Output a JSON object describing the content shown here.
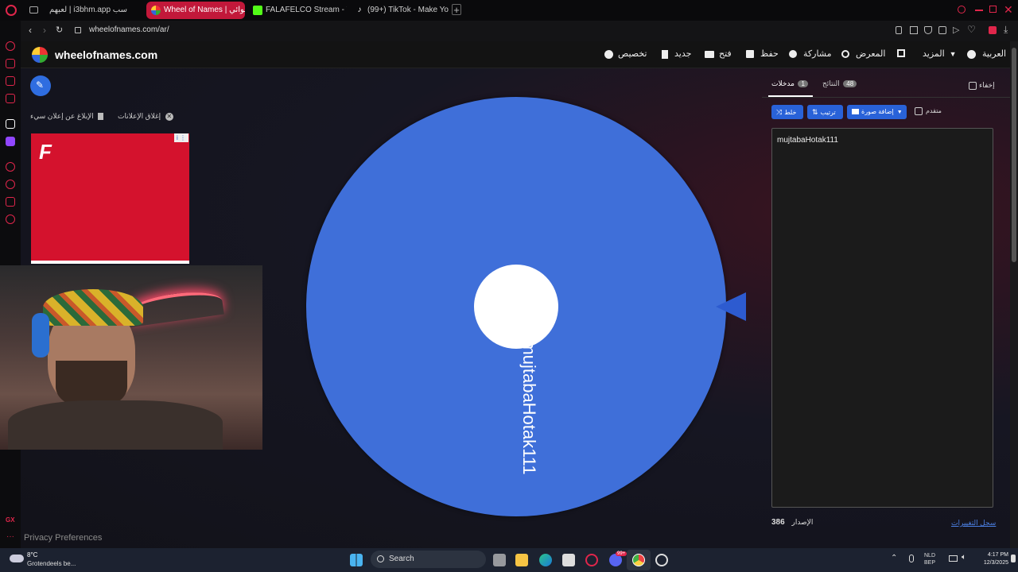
{
  "browser": {
    "tabs": [
      {
        "label": "لعبهم | i3bhm.app سب",
        "active": false
      },
      {
        "label": "Wheel of Names | عشوائي",
        "active": true
      },
      {
        "label": "FALAFELCO Stream - Wa",
        "active": false
      },
      {
        "label": "(99+) TikTok - Make Your",
        "active": false
      }
    ],
    "new_tab": "+",
    "url": "wheelofnames.com/ar/"
  },
  "site": {
    "logo_text": "wheelofnames.com",
    "nav": {
      "customize": "تخصيص",
      "new": "جديد",
      "open": "فتح",
      "save": "حفظ",
      "share": "مشاركة",
      "gallery": "المعرض",
      "more": "المزيد",
      "language": "العربية"
    }
  },
  "ads": {
    "report_ad": "الإبلاغ عن إعلان سيء",
    "close_ads": "إغلاق الإعلانات",
    "ad_logo": "F"
  },
  "wheel": {
    "entry": "mujtabaHotak111",
    "color": "#3f6fd9",
    "center_color": "#ffffff",
    "pointer_color": "#2d5bd0"
  },
  "panel": {
    "hide_label": "إخفاء",
    "tab_entries": "مدخلات",
    "entries_count": "1",
    "tab_results": "النتائج",
    "results_count": "48",
    "shuffle": "خلط",
    "sort": "ترتيب",
    "add_image": "إضافة صورة",
    "advanced": "متقدم",
    "entries_text": "mujtabaHotak111",
    "version_label": "الإصدار",
    "version_number": "386",
    "changelog": "سجل التغييرات"
  },
  "footer": {
    "privacy": "Privacy Preferences"
  },
  "taskbar": {
    "weather_temp": "8°C",
    "weather_desc": "Grotendeels be...",
    "search_placeholder": "Search",
    "lang_top": "NLD",
    "lang_bottom": "BEP",
    "time": "4:17 PM",
    "date": "12/3/2025",
    "notification_badge": "99+"
  },
  "colors": {
    "accent": "#c2183a",
    "button_blue": "#2962d8",
    "ad_red": "#d4122d"
  }
}
